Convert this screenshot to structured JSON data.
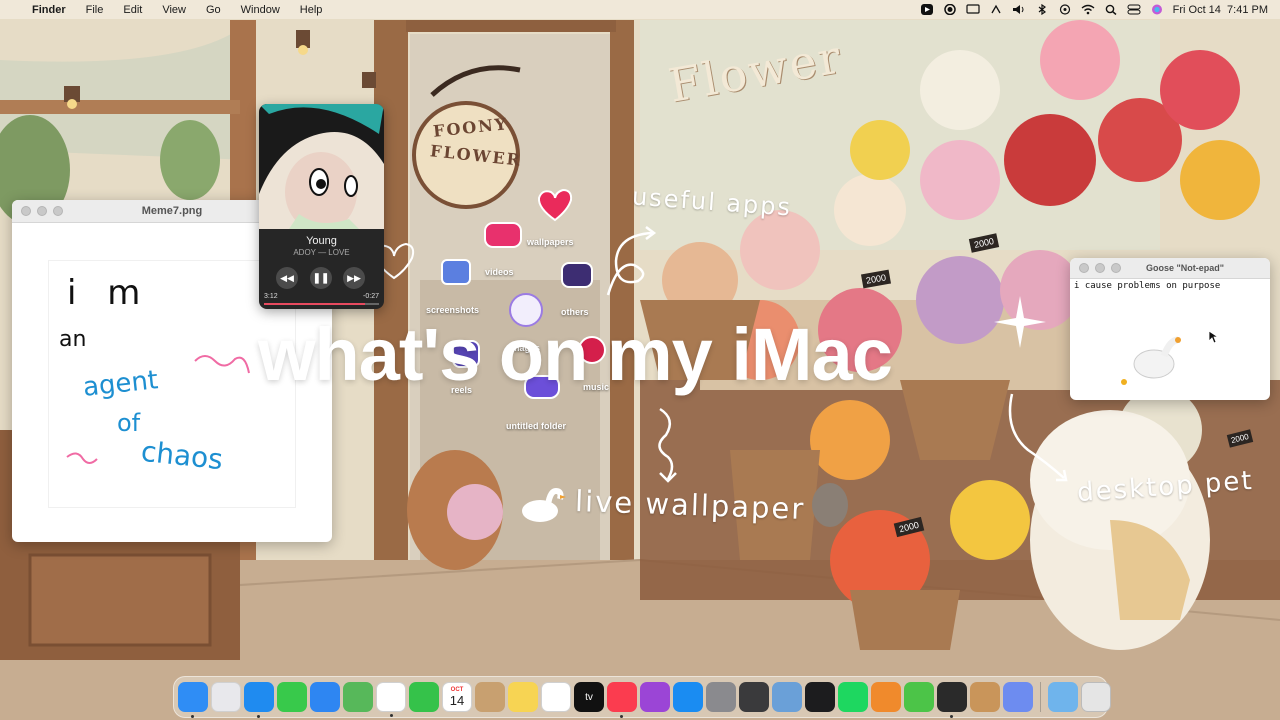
{
  "menubar": {
    "app": "Finder",
    "menus": [
      "File",
      "Edit",
      "View",
      "Go",
      "Window",
      "Help"
    ],
    "clock": "Fri Oct 14  7:41 PM"
  },
  "wallpaper": {
    "sign_text": "Flower",
    "shop_sign_line1": "FOONY",
    "shop_sign_line2": "FLOWER",
    "price_tags": [
      "2000",
      "2000",
      "2000",
      "2000"
    ]
  },
  "meme_window": {
    "title": "Meme7.png",
    "note_lines": [
      "i m",
      "an",
      "agent",
      "of",
      "chaos"
    ]
  },
  "music_player": {
    "track": "Young",
    "artist": "ADOY — LOVE",
    "elapsed": "3:12",
    "remaining": "-0:27",
    "progress": 0.88
  },
  "desktop_icons": {
    "wallpapers": "wallpapers",
    "videos": "videos",
    "others": "others",
    "screenshots": "screenshots",
    "images": "images",
    "reels": "reels",
    "music": "music",
    "untitled": "untitled folder"
  },
  "annotations": {
    "useful_apps": "useful apps",
    "live_wallpaper": "live wallpaper",
    "desktop_pet": "desktop pet"
  },
  "headline": "what's on my iMac",
  "goose_window": {
    "title": "Goose \"Not-epad\"",
    "body": "i cause problems on purpose"
  },
  "dock": {
    "apps": [
      {
        "icon": "finder-icon",
        "color": "#2f8df5",
        "dot": true
      },
      {
        "icon": "launchpad-icon",
        "color": "#e8e8ec",
        "dot": false
      },
      {
        "icon": "safari-icon",
        "color": "#1f8bf0",
        "dot": true
      },
      {
        "icon": "messages-icon",
        "color": "#38c94b",
        "dot": false
      },
      {
        "icon": "mail-icon",
        "color": "#2e86f2",
        "dot": false
      },
      {
        "icon": "maps-icon",
        "color": "#57b85a",
        "dot": false
      },
      {
        "icon": "photos-icon",
        "color": "#ffffff",
        "dot": true
      },
      {
        "icon": "facetime-icon",
        "color": "#35c24a",
        "dot": false
      },
      {
        "icon": "calendar-icon",
        "color": "#ffffff",
        "dot": false
      },
      {
        "icon": "contacts-icon",
        "color": "#c8a070",
        "dot": false
      },
      {
        "icon": "notes-icon",
        "color": "#f7d453",
        "dot": false
      },
      {
        "icon": "reminders-icon",
        "color": "#ffffff",
        "dot": false
      },
      {
        "icon": "appletv-icon",
        "color": "#111111",
        "dot": false
      },
      {
        "icon": "music-icon",
        "color": "#fb3c4f",
        "dot": true
      },
      {
        "icon": "podcasts-icon",
        "color": "#9b45d6",
        "dot": false
      },
      {
        "icon": "appstore-icon",
        "color": "#1a8cf2",
        "dot": false
      },
      {
        "icon": "systemprefs-icon",
        "color": "#8a8a8e",
        "dot": false
      },
      {
        "icon": "quicktime-icon",
        "color": "#3a3a3c",
        "dot": false
      },
      {
        "icon": "preview-icon",
        "color": "#6aa0d8",
        "dot": false
      },
      {
        "icon": "voice-memos-icon",
        "color": "#1c1c1e",
        "dot": false
      },
      {
        "icon": "spotify-icon",
        "color": "#1ed760",
        "dot": false
      },
      {
        "icon": "cursor-app-icon",
        "color": "#f08a2c",
        "dot": false
      },
      {
        "icon": "todo-icon",
        "color": "#4cc448",
        "dot": false
      },
      {
        "icon": "screen-recorder-icon",
        "color": "#2a2a2a",
        "dot": true
      },
      {
        "icon": "archive-icon",
        "color": "#c9955a",
        "dot": false
      },
      {
        "icon": "infinity-icon",
        "color": "#6d8cf0",
        "dot": false
      }
    ],
    "calendar_month": "OCT",
    "calendar_day": "14",
    "tv_label": "tv"
  }
}
